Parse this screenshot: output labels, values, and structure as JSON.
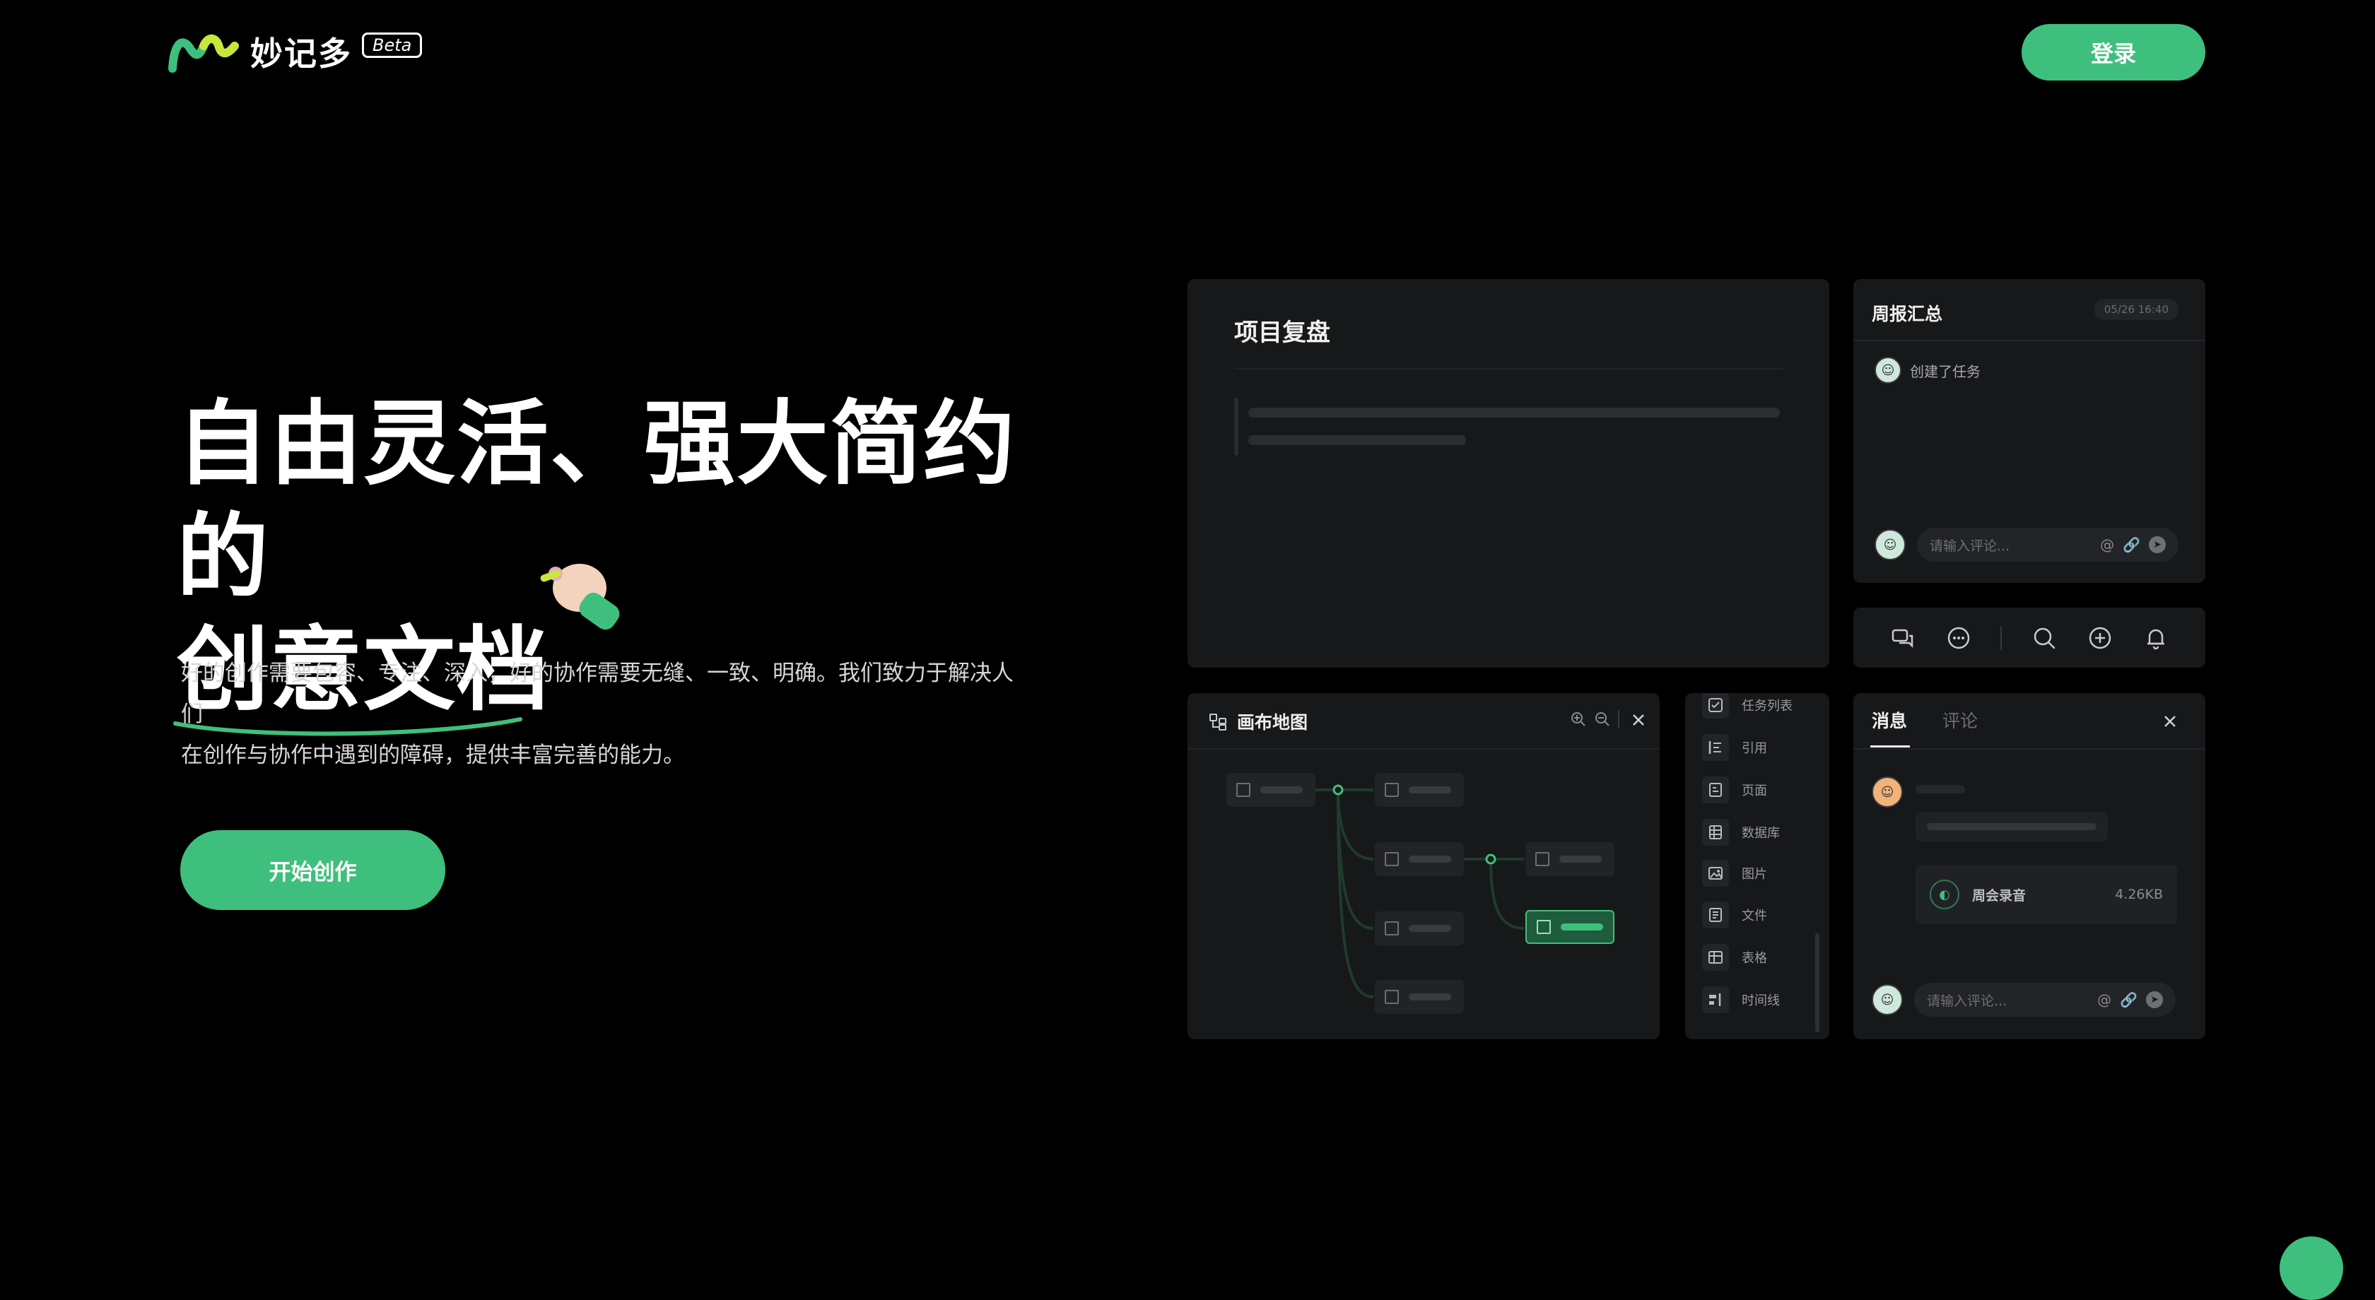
{
  "header": {
    "logo_text": "妙记多",
    "beta_label": "Beta",
    "login_label": "登录"
  },
  "hero": {
    "title_line1": "自由灵活、强大简约的",
    "title_line2": "创意文档",
    "description_line1": "好的创作需要包容、专注、深入，好的协作需要无缝、一致、明确。我们致力于解决人们",
    "description_line2": "在创作与协作中遇到的障碍，提供丰富完善的能力。",
    "start_label": "开始创作"
  },
  "project_panel": {
    "title": "项目复盘"
  },
  "weekly_panel": {
    "title": "周报汇总",
    "date": "05/26 16:40",
    "activity_text": "创建了任务",
    "comment_placeholder": "请输入评论..."
  },
  "canvas_panel": {
    "title": "画布地图"
  },
  "blocks_panel": {
    "items": [
      {
        "label": "任务列表",
        "icon": "checkbox-icon"
      },
      {
        "label": "引用",
        "icon": "quote-icon"
      },
      {
        "label": "页面",
        "icon": "page-icon"
      },
      {
        "label": "数据库",
        "icon": "database-icon"
      },
      {
        "label": "图片",
        "icon": "image-icon"
      },
      {
        "label": "文件",
        "icon": "file-icon"
      },
      {
        "label": "表格",
        "icon": "table-icon"
      },
      {
        "label": "时间线",
        "icon": "timeline-icon"
      }
    ]
  },
  "message_panel": {
    "tab_messages": "消息",
    "tab_comments": "评论",
    "file_name": "周会录音",
    "file_size": "4.26KB",
    "comment_placeholder": "请输入评论..."
  },
  "colors": {
    "accent": "#3fbf7d",
    "background": "#000000",
    "panel": "#17181a"
  }
}
